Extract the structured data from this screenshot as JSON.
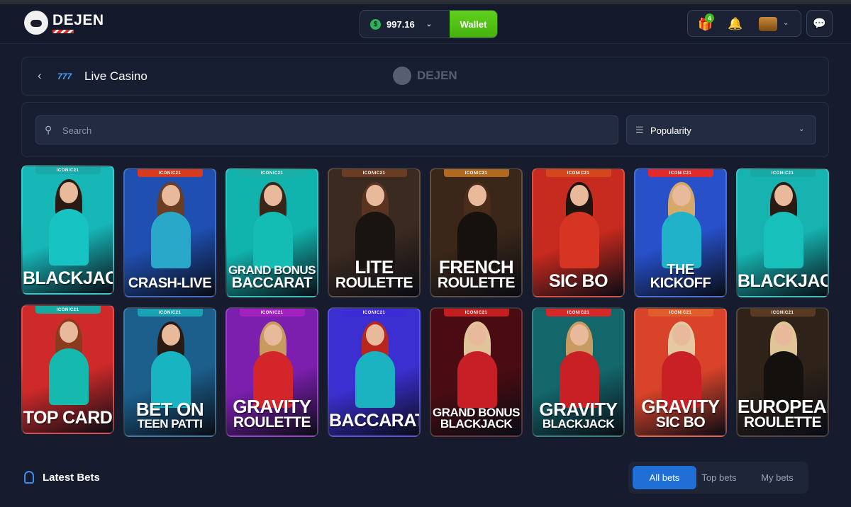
{
  "brand": {
    "name": "DEJEN"
  },
  "header": {
    "balance": "997.16",
    "currency_symbol": "$",
    "wallet_label": "Wallet",
    "gift_badge": "4"
  },
  "page": {
    "title": "Live Casino",
    "watermark": "DEJEN"
  },
  "search": {
    "placeholder": "Search"
  },
  "sort": {
    "selected": "Popularity"
  },
  "games": [
    {
      "tag": "ICONIC21",
      "line1": "BLACKJACK",
      "line2": "",
      "bg": "#17b7b8",
      "tagColor": "#1aa9a9",
      "dress": "#18c3c3",
      "hair": "#2a1a14"
    },
    {
      "tag": "ICONIC21",
      "line1": "CRASH-LIVE",
      "line2": "",
      "bg": "#1f4fb0",
      "tagColor": "#d83a1f",
      "dress": "#2aa8c9",
      "hair": "#6b3d22"
    },
    {
      "tag": "ICONIC21",
      "line1": "GRAND BONUS",
      "line2": "BACCARAT",
      "bg": "#11b3ad",
      "tagColor": "#1bb0a7",
      "dress": "#14bdb4",
      "hair": "#3b2418"
    },
    {
      "tag": "ICONIC21",
      "line1": "LITE",
      "line2": "ROULETTE",
      "bg": "#3b2a1f",
      "tagColor": "#6a3d22",
      "dress": "#1a1410",
      "hair": "#5a3420"
    },
    {
      "tag": "ICONIC21",
      "line1": "FRENCH",
      "line2": "ROULETTE",
      "bg": "#3a2719",
      "tagColor": "#b0691f",
      "dress": "#16110d",
      "hair": "#4a2c1b"
    },
    {
      "tag": "ICONIC21",
      "line1": "SIC BO",
      "line2": "",
      "bg": "#c72a1e",
      "tagColor": "#d4471c",
      "dress": "#d63524",
      "hair": "#1e1410"
    },
    {
      "tag": "ICONIC21",
      "line1": "THE KICKOFF",
      "line2": "",
      "bg": "#2750c9",
      "tagColor": "#e22a2a",
      "dress": "#1fb2c9",
      "hair": "#d6a86a"
    },
    {
      "tag": "ICONIC21",
      "line1": "BLACKJACK",
      "line2": "",
      "bg": "#16b3b0",
      "tagColor": "#18a8a5",
      "dress": "#17c0bb",
      "hair": "#2b1a14"
    },
    {
      "tag": "ICONIC21",
      "line1": "TOP CARD",
      "line2": "",
      "bg": "#cf2a2a",
      "tagColor": "#16a9a2",
      "dress": "#16b9ae",
      "hair": "#8c3a1e"
    },
    {
      "tag": "ICONIC21",
      "line1": "BET ON",
      "line2": "TEEN PATTI",
      "bg": "#1c5f8c",
      "tagColor": "#18a2b3",
      "dress": "#18b4c2",
      "hair": "#2a1a14"
    },
    {
      "tag": "ICONIC21",
      "line1": "GRAVITY",
      "line2": "ROULETTE",
      "bg": "#7c1fae",
      "tagColor": "#a21fc0",
      "dress": "#d4262a",
      "hair": "#c79a5e"
    },
    {
      "tag": "ICONIC21",
      "line1": "BACCARAT",
      "line2": "",
      "bg": "#3b2fd1",
      "tagColor": "#3c2ad6",
      "dress": "#1bb2c2",
      "hair": "#b9271c"
    },
    {
      "tag": "ICONIC21",
      "line1": "GRAND BONUS",
      "line2": "BLACKJACK",
      "bg": "#4a0c12",
      "tagColor": "#c41f1f",
      "dress": "#c81e25",
      "hair": "#e0c49a"
    },
    {
      "tag": "ICONIC21",
      "line1": "GRAVITY",
      "line2": "BLACKJACK",
      "bg": "#13666a",
      "tagColor": "#d62828",
      "dress": "#c82024",
      "hair": "#c89b62"
    },
    {
      "tag": "ICONIC21",
      "line1": "GRAVITY",
      "line2": "SIC BO",
      "bg": "#d8432a",
      "tagColor": "#e05c2a",
      "dress": "#c82024",
      "hair": "#e4c9a3"
    },
    {
      "tag": "ICONIC21",
      "line1": "EUROPEAN",
      "line2": "ROULETTE",
      "bg": "#2e2219",
      "tagColor": "#5b3a22",
      "dress": "#14100d",
      "hair": "#e0c596"
    }
  ],
  "latest_bets": {
    "title": "Latest Bets",
    "tabs": [
      "All bets",
      "Top bets",
      "My bets"
    ],
    "active_tab": 0
  }
}
